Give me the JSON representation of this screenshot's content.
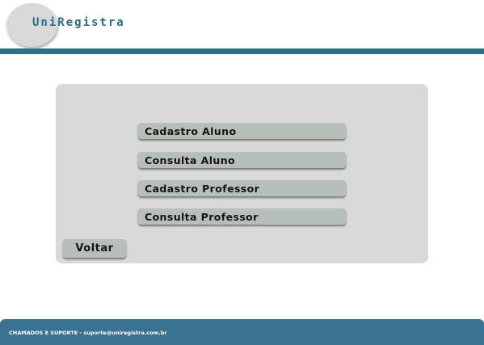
{
  "header": {
    "logo_text": "UniRegistra"
  },
  "menu": {
    "items": [
      {
        "label": "Cadastro Aluno"
      },
      {
        "label": "Consulta Aluno"
      },
      {
        "label": "Cadastro Professor"
      },
      {
        "label": "Consulta Professor"
      }
    ],
    "back_label": "Voltar"
  },
  "footer": {
    "text": "CHAMADOS E SUPORTE - suporte@uniregistra.com.br"
  },
  "colors": {
    "brand": "#2f6f8a",
    "button": "#b7c0b8",
    "panel": "#d9d9d9",
    "footer": "#3a7392"
  }
}
